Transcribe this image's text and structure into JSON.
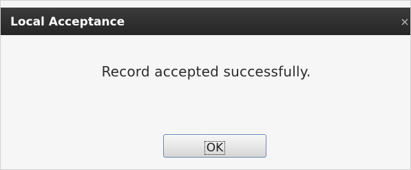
{
  "dialog": {
    "title": "Local Acceptance",
    "close_glyph": "×",
    "message": "Record accepted successfully.",
    "ok_label": "OK"
  },
  "colors": {
    "titlebar": "#2f2f2f",
    "title_text": "#ffffff",
    "body_background": "#f6f6f6",
    "button_border": "#6a86b5"
  },
  "icons": {
    "close": "close-icon"
  }
}
